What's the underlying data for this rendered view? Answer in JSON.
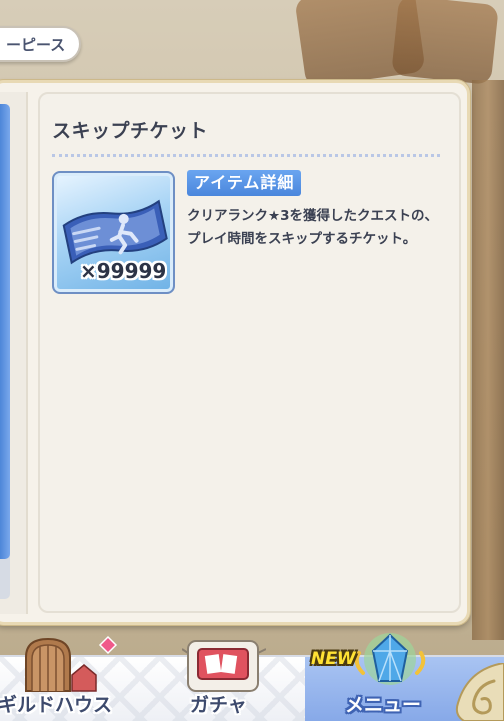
{
  "top_tab": {
    "label": "ーピース"
  },
  "detail": {
    "title": "スキップチケット",
    "item_count": "×99999",
    "section_label": "アイテム詳細",
    "description": "クリアランク★3を獲得したクエストの、プレイ時間をスキップするチケット。"
  },
  "scrollbar": {
    "position_fraction": 0.0,
    "visible_fraction": 0.92
  },
  "bottom_nav": {
    "items": [
      {
        "label": "ギルドハウス",
        "icon": "guild-house-icon"
      },
      {
        "label": "ガチャ",
        "icon": "gacha-icon"
      },
      {
        "label": "メニュー",
        "icon": "menu-crystal-icon",
        "badge": "NEW",
        "active": true
      }
    ]
  },
  "colors": {
    "accent_blue": "#4a86dc",
    "text_dark": "#3b4152",
    "panel_bg": "#f6f2ea",
    "menu_active_bg": "#86a8e8",
    "new_badge": "#ffe234"
  }
}
